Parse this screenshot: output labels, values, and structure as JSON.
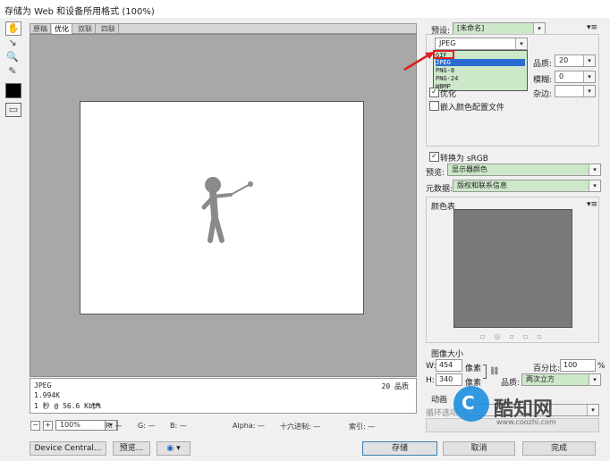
{
  "window": {
    "title": "存储为 Web 和设备所用格式 (100%)"
  },
  "tabs": [
    "原稿",
    "优化",
    "双联",
    "四联"
  ],
  "image_info": {
    "format": "JPEG",
    "size": "1.994K",
    "speed": "1 秒 @ 56.6 Kbps",
    "quality": "20 品质"
  },
  "statusbar": {
    "zoom": "100%",
    "r": "R: —",
    "g": "G: —",
    "b": "B: —",
    "alpha": "Alpha: —",
    "hex": "十六进制: —",
    "index": "索引: —"
  },
  "buttons": {
    "device": "Device Central...",
    "preview": "预览...",
    "save": "存储",
    "cancel": "取消",
    "done": "完成"
  },
  "right_panel": {
    "preset_label": "预设:",
    "preset_value": "[未命名]",
    "format_value": "JPEG",
    "format_options": [
      "GIF",
      "JPEG",
      "PNG-8",
      "PNG-24",
      "WBMP"
    ],
    "quality_label": "品质:",
    "quality_value": "20",
    "blur_label": "模糊:",
    "blur_value": "0",
    "matte_label": "杂边:",
    "optimized_label": "优化",
    "embed_profile_label": "嵌入颜色配置文件",
    "convert_srgb_label": "转换为 sRGB",
    "preview_label": "预览:",
    "preview_value": "显示器颜色",
    "metadata_label": "元数据:",
    "metadata_value": "版权和联系信息",
    "color_table_label": "颜色表",
    "image_size_label": "图像大小",
    "w_label": "W:",
    "w_value": "454",
    "h_label": "H:",
    "h_value": "340",
    "px_label": "像素",
    "percent_label": "百分比:",
    "percent_value": "100",
    "percent_unit": "%",
    "resample_label": "品质:",
    "resample_value": "两次立方",
    "anim_label": "动画",
    "loop_label": "循环选项"
  },
  "watermark": {
    "text": "酷知网",
    "url": "www.coozhi.com"
  },
  "colors": {
    "selection_green": "#cde8c9",
    "highlight_blue": "#2a6bd1",
    "arrow_red": "#e02020"
  }
}
